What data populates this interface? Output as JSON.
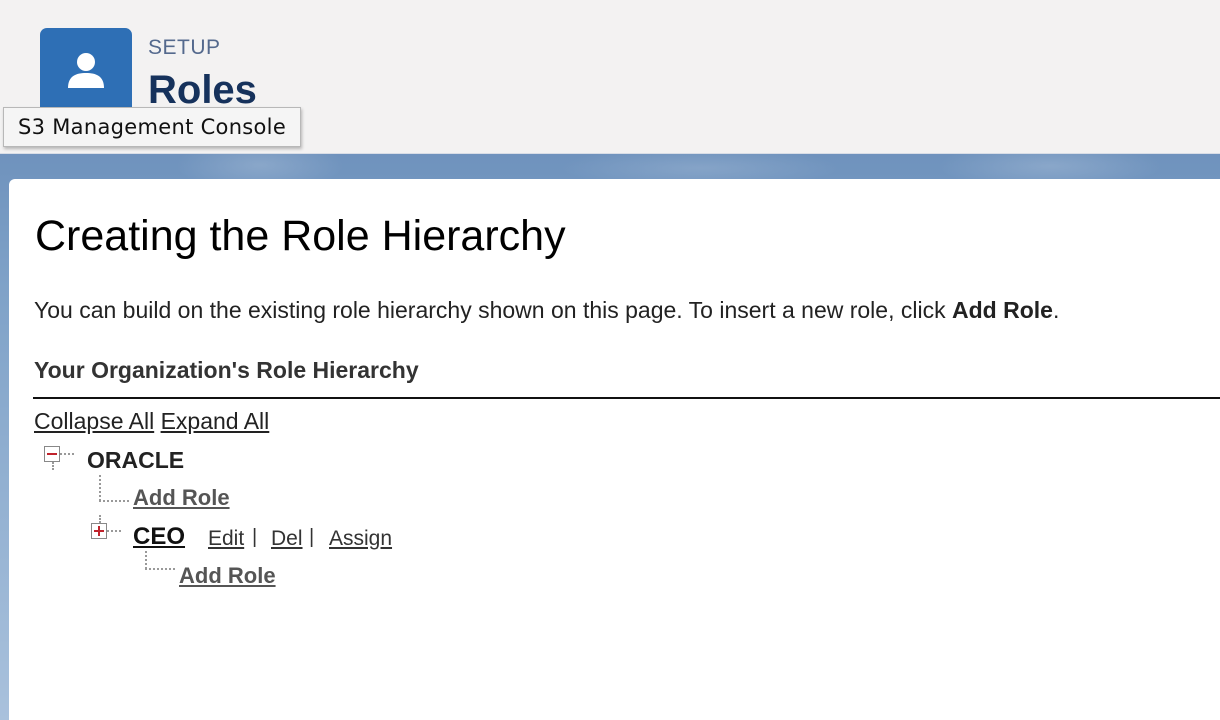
{
  "header": {
    "section": "SETUP",
    "title": "Roles"
  },
  "tooltip": "S3 Management Console",
  "main": {
    "heading": "Creating the Role Hierarchy",
    "intro_prefix": "You can build on the existing role hierarchy shown on this page. To insert a new role, click ",
    "intro_bold": "Add Role",
    "intro_suffix": ".",
    "section_title": "Your Organization's Role Hierarchy",
    "collapse_all": "Collapse All",
    "expand_all": "Expand All"
  },
  "tree": {
    "root": {
      "label": "ORACLE",
      "add_role": "Add Role"
    },
    "child": {
      "label": "CEO",
      "actions": {
        "edit": "Edit",
        "del": "Del",
        "assign": "Assign",
        "separator": "|"
      },
      "add_role": "Add Role"
    }
  },
  "icons": {
    "header_icon": "user-icon",
    "collapse_toggle": "minus-box-icon",
    "expand_toggle": "plus-box-icon"
  },
  "colors": {
    "header_icon_bg": "#2e6fb5",
    "title": "#16325c",
    "toggle_mark": "#c0232c"
  }
}
